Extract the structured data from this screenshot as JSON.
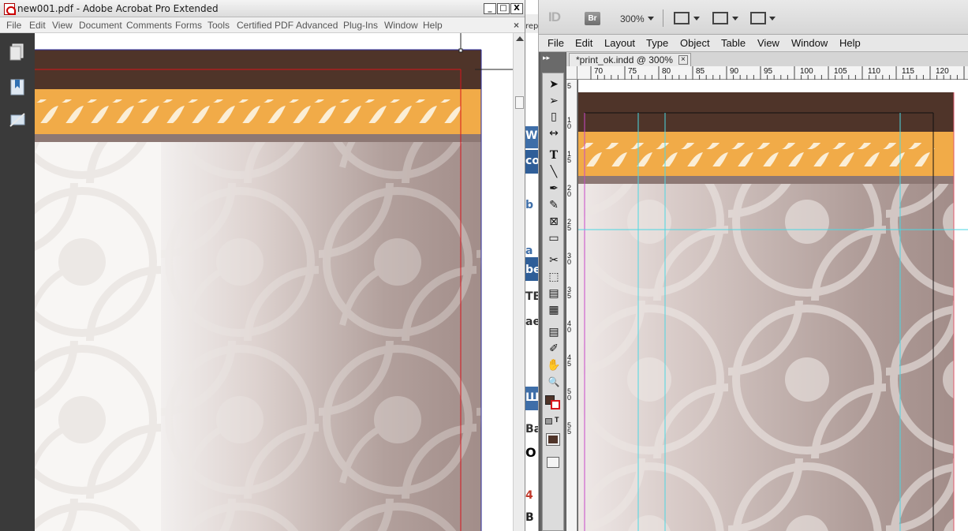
{
  "acrobat": {
    "title": "new001.pdf - Adobe Acrobat Pro Extended",
    "controls": {
      "minimize": "_",
      "maximize": "□",
      "close": "X"
    },
    "menu": [
      "File",
      "Edit",
      "View",
      "Document",
      "Comments",
      "Forms",
      "Tools",
      "Certified PDF",
      "Advanced",
      "Plug-Ins",
      "Window",
      "Help"
    ],
    "menu_close": "×",
    "sidebar_icons": [
      "pages-icon",
      "bookmarks-icon",
      "signatures-icon"
    ]
  },
  "sliver": {
    "texts": [
      "rep",
      "Wi",
      "co",
      "b",
      "a",
      "be",
      "TB",
      "ae",
      "Ш",
      "Ba",
      "O",
      "4",
      "B"
    ]
  },
  "indesign": {
    "logo": "ID",
    "bridge": "Br",
    "zoom": "300%",
    "menu": [
      "File",
      "Edit",
      "Layout",
      "Type",
      "Object",
      "Table",
      "View",
      "Window",
      "Help"
    ],
    "tab": "*print_ok.indd @ 300%",
    "tab_close": "×",
    "collapse": "▸▸",
    "ruler_top": [
      "70",
      "75",
      "80",
      "85",
      "90",
      "95",
      "100",
      "105",
      "110",
      "115",
      "120"
    ],
    "ruler_left": [
      "5",
      "10",
      "15",
      "20",
      "25",
      "30",
      "35",
      "40",
      "45",
      "50",
      "55"
    ],
    "tools": [
      {
        "icon": "selection-tool-icon",
        "glyph": "➤"
      },
      {
        "icon": "direct-selection-tool-icon",
        "glyph": "➢"
      },
      {
        "icon": "page-tool-icon",
        "glyph": "▯"
      },
      {
        "icon": "gap-tool-icon",
        "glyph": "↔"
      },
      {
        "icon": "type-tool-icon",
        "glyph": "T"
      },
      {
        "icon": "line-tool-icon",
        "glyph": "╲"
      },
      {
        "icon": "pen-tool-icon",
        "glyph": "✒"
      },
      {
        "icon": "pencil-tool-icon",
        "glyph": "✎"
      },
      {
        "icon": "rectangle-frame-tool-icon",
        "glyph": "⊠"
      },
      {
        "icon": "rectangle-tool-icon",
        "glyph": "▭"
      },
      {
        "icon": "scissors-tool-icon",
        "glyph": "✂"
      },
      {
        "icon": "free-transform-tool-icon",
        "glyph": "⬚"
      },
      {
        "icon": "gradient-tool-icon",
        "glyph": "▤"
      },
      {
        "icon": "gradient-feather-tool-icon",
        "glyph": "▦"
      },
      {
        "icon": "note-tool-icon",
        "glyph": "▤"
      },
      {
        "icon": "eyedropper-tool-icon",
        "glyph": "✐"
      },
      {
        "icon": "hand-tool-icon",
        "glyph": "✋"
      },
      {
        "icon": "zoom-tool-icon",
        "glyph": "🔍"
      }
    ],
    "formatting_text_label": "T",
    "colors": {
      "fill": "#4f3429",
      "guide": "#4bd7e3"
    }
  },
  "design_colors": {
    "brown": "#4f3429",
    "rope_orange": "#f0a944",
    "rope_cream": "#fbeed6",
    "shadow": "#8d7874",
    "gradient_end": "#a28d89",
    "bleed_red": "#d8141a",
    "margin_blue": "#2b2b9a"
  }
}
